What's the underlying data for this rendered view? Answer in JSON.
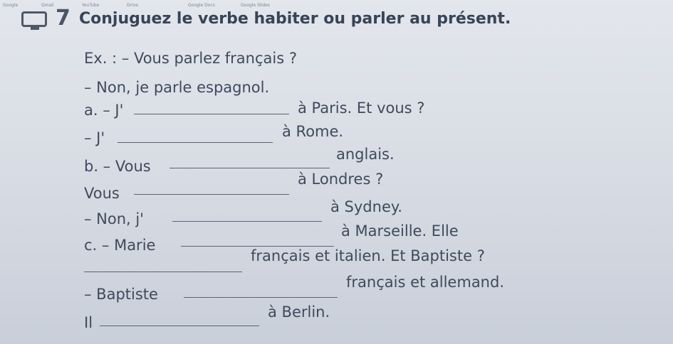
{
  "bookmarks": [
    "Google",
    "Gmail",
    "YouTube",
    "Drive",
    "Google Docs",
    "Google Slides"
  ],
  "exercise": {
    "number": "7",
    "title": "Conjuguez le verbe habiter ou parler au présent.",
    "lines": [
      "Ex. : – Vous parlez français ?",
      "– Non, je parle espagnol."
    ],
    "items": [
      {
        "prefix": "a. – J'",
        "suffix": "à Paris. Et vous ?"
      },
      {
        "prefix": "– J'",
        "suffix": "à Rome."
      },
      {
        "prefix": "b. – Vous",
        "suffix": "anglais."
      },
      {
        "prefix": "Vous",
        "suffix": "à Londres ?"
      },
      {
        "prefix": "– Non, j'",
        "suffix": "à Sydney."
      },
      {
        "prefix": "c. – Marie",
        "suffix": "à Marseille. Elle"
      },
      {
        "prefix": "",
        "suffix": "français et italien. Et Baptiste ?"
      },
      {
        "prefix": "– Baptiste",
        "suffix": "français et allemand."
      },
      {
        "prefix": "Il",
        "suffix": "à Berlin."
      }
    ]
  }
}
